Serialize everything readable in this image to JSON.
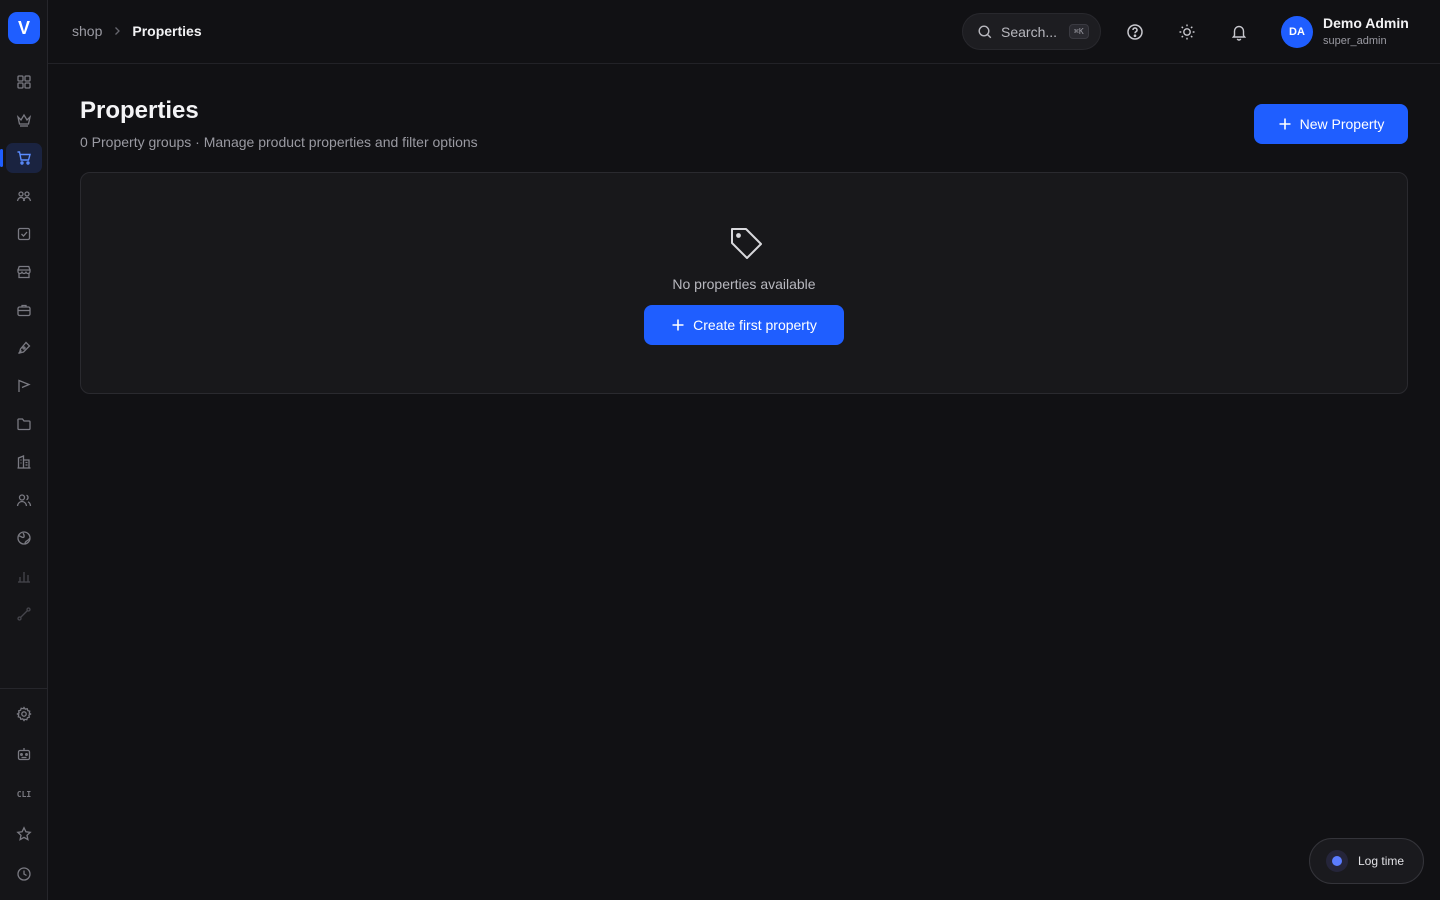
{
  "app": {
    "logo_letter": "V",
    "brand_color": "#1f5eff"
  },
  "sidebar": {
    "items": [
      {
        "name": "dashboard",
        "icon": "grid-icon"
      },
      {
        "name": "crown",
        "icon": "crown-icon"
      },
      {
        "name": "shop",
        "icon": "cart-icon",
        "active": true
      },
      {
        "name": "users",
        "icon": "users-icon"
      },
      {
        "name": "tasks",
        "icon": "checkbox-icon"
      },
      {
        "name": "store",
        "icon": "store-icon"
      },
      {
        "name": "jobs",
        "icon": "briefcase-icon"
      },
      {
        "name": "design",
        "icon": "pen-icon"
      },
      {
        "name": "marketing",
        "icon": "flag-icon"
      },
      {
        "name": "files",
        "icon": "folder-icon"
      },
      {
        "name": "buildings",
        "icon": "building-icon"
      },
      {
        "name": "team",
        "icon": "team-icon"
      },
      {
        "name": "web",
        "icon": "globe-icon"
      },
      {
        "name": "analytics",
        "icon": "bar-chart-icon"
      },
      {
        "name": "workflow",
        "icon": "route-icon"
      }
    ],
    "bottom_items": [
      {
        "name": "settings",
        "icon": "gear-icon"
      },
      {
        "name": "bot",
        "icon": "robot-icon"
      },
      {
        "name": "cli",
        "label": "CLI"
      },
      {
        "name": "favorites",
        "icon": "star-icon"
      },
      {
        "name": "history",
        "icon": "clock-icon"
      }
    ]
  },
  "header": {
    "breadcrumb": {
      "parent": "shop",
      "separator": ">",
      "current": "Properties"
    },
    "search": {
      "placeholder": "Search...",
      "shortcut": "⌘K"
    },
    "user": {
      "initials": "DA",
      "name": "Demo Admin",
      "role": "super_admin"
    }
  },
  "main": {
    "title": "Properties",
    "subtitle": "0 Property groups · Manage product properties and filter options",
    "new_button_label": "New Property",
    "empty_state": {
      "icon": "tag-icon",
      "message": "No properties available",
      "button_label": "Create first property"
    }
  },
  "floating": {
    "log_time_label": "Log time"
  }
}
